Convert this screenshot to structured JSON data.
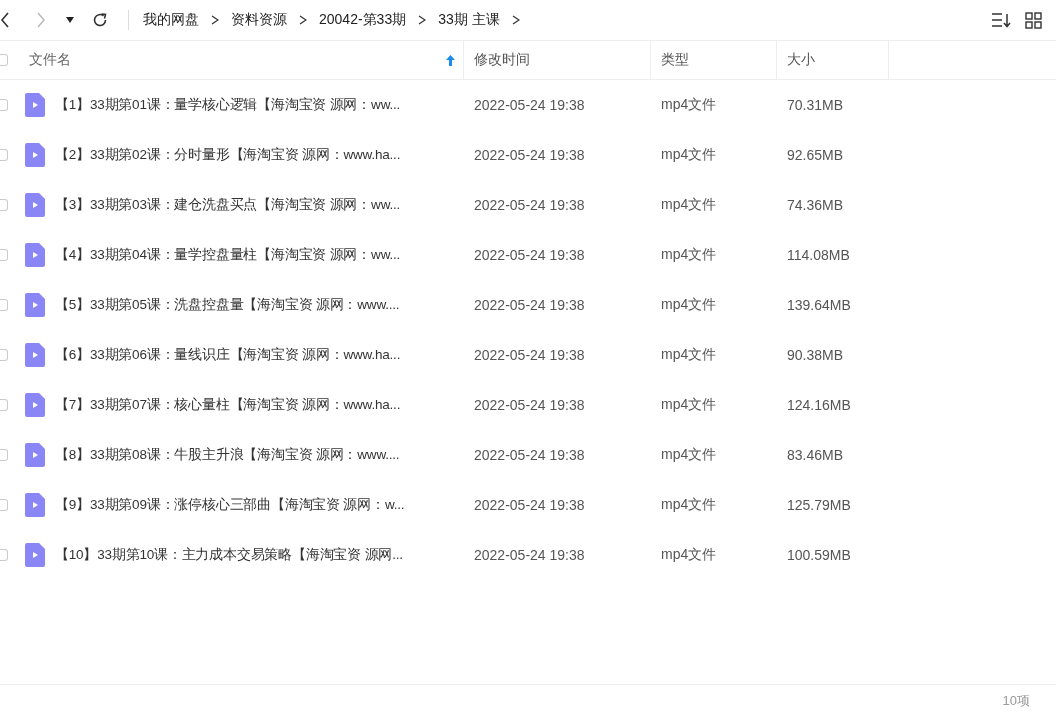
{
  "toolbar": {
    "breadcrumbs": [
      "我的网盘",
      "资料资源",
      "20042-第33期",
      "33期 主课"
    ]
  },
  "table": {
    "select_all_checked": false,
    "columns": [
      {
        "label": "文件名",
        "sorted": true
      },
      {
        "label": "修改时间",
        "sorted": false
      },
      {
        "label": "类型",
        "sorted": false
      },
      {
        "label": "大小",
        "sorted": false
      }
    ],
    "rows": [
      {
        "name": "【1】33期第01课：量学核心逻辑【海淘宝资 源网：ww...",
        "time": "2022-05-24 19:38",
        "type": "mp4文件",
        "size": "70.31MB",
        "checked": false
      },
      {
        "name": "【2】33期第02课：分时量形【海淘宝资 源网：www.ha...",
        "time": "2022-05-24 19:38",
        "type": "mp4文件",
        "size": "92.65MB",
        "checked": false
      },
      {
        "name": "【3】33期第03课：建仓洗盘买点【海淘宝资 源网：ww...",
        "time": "2022-05-24 19:38",
        "type": "mp4文件",
        "size": "74.36MB",
        "checked": false
      },
      {
        "name": "【4】33期第04课：量学控盘量柱【海淘宝资 源网：ww...",
        "time": "2022-05-24 19:38",
        "type": "mp4文件",
        "size": "114.08MB",
        "checked": false
      },
      {
        "name": "【5】33期第05课：洗盘控盘量【海淘宝资 源网：www....",
        "time": "2022-05-24 19:38",
        "type": "mp4文件",
        "size": "139.64MB",
        "checked": false
      },
      {
        "name": "【6】33期第06课：量线识庄【海淘宝资 源网：www.ha...",
        "time": "2022-05-24 19:38",
        "type": "mp4文件",
        "size": "90.38MB",
        "checked": false
      },
      {
        "name": "【7】33期第07课：核心量柱【海淘宝资 源网：www.ha...",
        "time": "2022-05-24 19:38",
        "type": "mp4文件",
        "size": "124.16MB",
        "checked": false
      },
      {
        "name": "【8】33期第08课：牛股主升浪【海淘宝资 源网：www....",
        "time": "2022-05-24 19:38",
        "type": "mp4文件",
        "size": "83.46MB",
        "checked": false
      },
      {
        "name": "【9】33期第09课：涨停核心三部曲【海淘宝资 源网：w...",
        "time": "2022-05-24 19:38",
        "type": "mp4文件",
        "size": "125.79MB",
        "checked": false
      },
      {
        "name": "【10】33期第10课：主力成本交易策略【海淘宝资 源网...",
        "time": "2022-05-24 19:38",
        "type": "mp4文件",
        "size": "100.59MB",
        "checked": false
      }
    ]
  },
  "status_bar": {
    "count": "10项"
  }
}
